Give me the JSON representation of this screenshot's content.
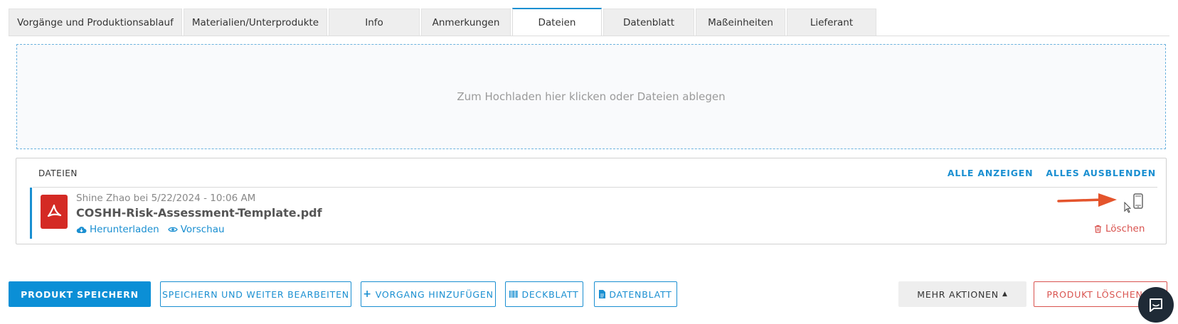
{
  "tabs": [
    {
      "label": "Vorgänge und Produktionsablauf"
    },
    {
      "label": "Materialien/Unterprodukte"
    },
    {
      "label": "Info"
    },
    {
      "label": "Anmerkungen"
    },
    {
      "label": "Dateien"
    },
    {
      "label": "Datenblatt"
    },
    {
      "label": "Maßeinheiten"
    },
    {
      "label": "Lieferant"
    }
  ],
  "active_tab": "Dateien",
  "dropzone": {
    "text": "Zum Hochladen hier klicken oder Dateien ablegen"
  },
  "files_panel": {
    "title": "DATEIEN",
    "show_all": "ALLE ANZEIGEN",
    "hide_all": "ALLES AUSBLENDEN",
    "file": {
      "meta": "Shine Zhao bei 5/22/2024 - 10:06 AM",
      "name": "COSHH-Risk-Assessment-Template.pdf",
      "download": "Herunterladen",
      "preview": "Vorschau",
      "delete": "Löschen"
    }
  },
  "buttons": {
    "save_product": "PRODUKT SPEICHERN",
    "save_continue": "SPEICHERN UND WEITER BEARBEITEN",
    "add_operation": "VORGANG HINZUFÜGEN",
    "cover_sheet": "DECKBLATT",
    "datasheet": "DATENBLATT",
    "more_actions": "MEHR AKTIONEN",
    "delete_product": "PRODUKT LÖSCHEN"
  },
  "colors": {
    "accent": "#1a8fd1",
    "primary_button": "#0b8fd6",
    "danger": "#d9534f",
    "pdf": "#d42a24",
    "annotation_arrow": "#e4542c"
  }
}
